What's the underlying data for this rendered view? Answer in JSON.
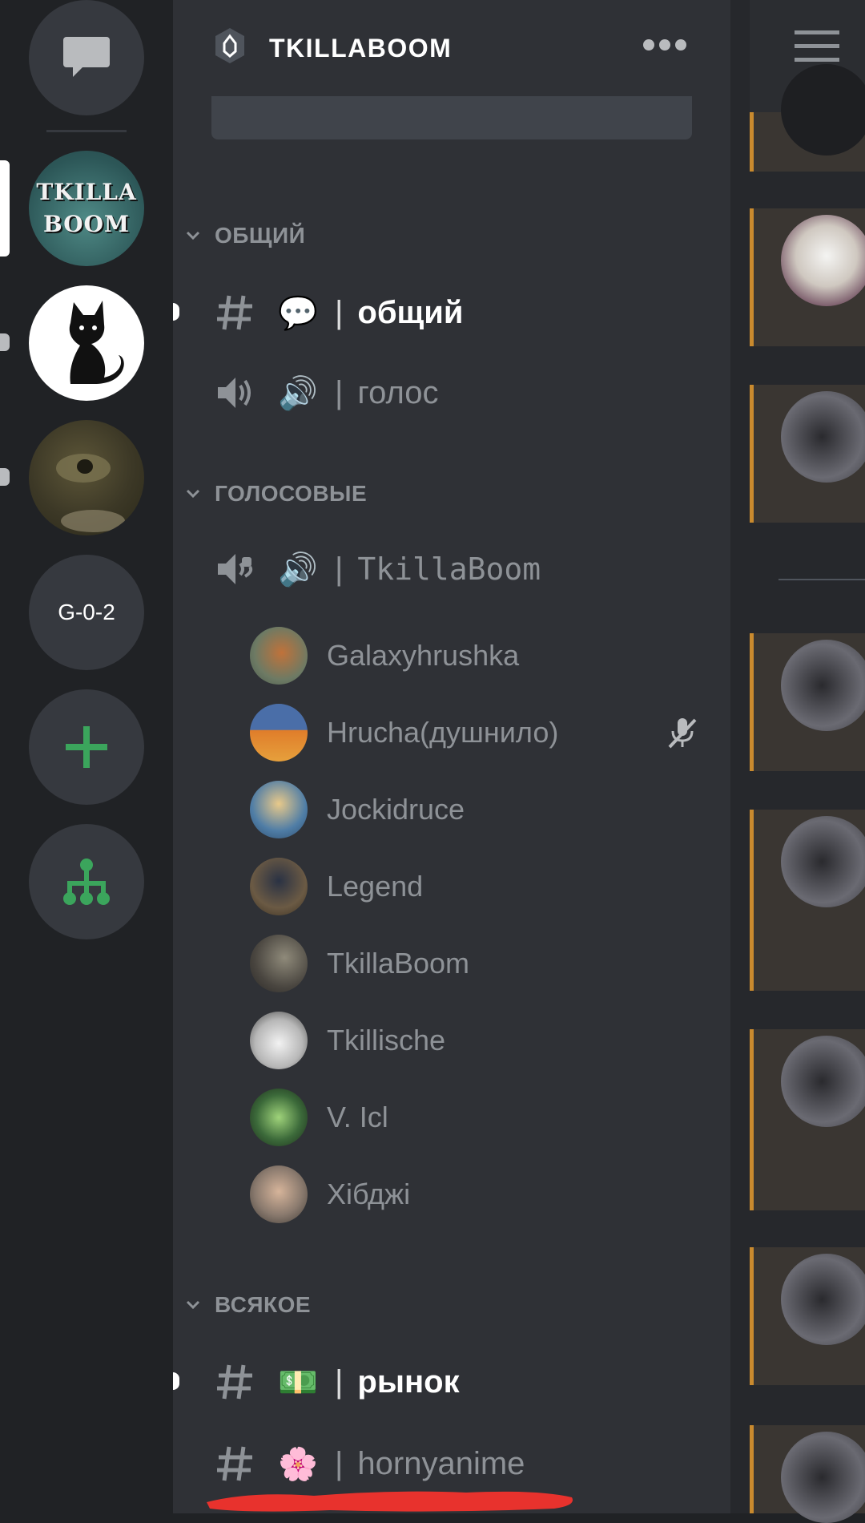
{
  "server_rail": {
    "servers": [
      {
        "name": "direct-messages",
        "icon": "chat-bubble-icon"
      },
      {
        "name": "tkillaboom",
        "label_line1": "TKILLA",
        "label_line2": "BOOM",
        "active": true
      },
      {
        "name": "cat-server",
        "icon": "black-cat-icon",
        "unread": true
      },
      {
        "name": "photo-server",
        "unread": true
      },
      {
        "name": "g02",
        "label": "G-0-2"
      },
      {
        "name": "add-server",
        "label": "+"
      },
      {
        "name": "explore",
        "icon": "hub-tree-icon"
      }
    ]
  },
  "sidebar": {
    "server_name": "TKILLABOOM",
    "categories": [
      {
        "name": "ОБЩИЙ",
        "channels": [
          {
            "type": "text",
            "emoji": "💬",
            "name": "общий",
            "unread": true
          },
          {
            "type": "voice",
            "emoji": "🔊",
            "name": "голос",
            "unread": false
          }
        ]
      },
      {
        "name": "ГОЛОСОВЫЕ",
        "channels": [
          {
            "type": "voice",
            "emoji": "🔊",
            "name": "TkillaBoom"
          }
        ],
        "voice_users": [
          {
            "name": "Galaxyhrushka",
            "muted": false
          },
          {
            "name": "Hrucha(душнило)",
            "muted": true
          },
          {
            "name": "Jockidruce",
            "muted": false
          },
          {
            "name": "Legend",
            "muted": false
          },
          {
            "name": "TkillaBoom",
            "muted": false
          },
          {
            "name": "Tkillische",
            "muted": false
          },
          {
            "name": "V. Icl",
            "muted": false
          },
          {
            "name": "Хібджі",
            "muted": false
          }
        ]
      },
      {
        "name": "ВСЯКОЕ",
        "channels": [
          {
            "type": "text",
            "emoji": "💵",
            "name": "рынок",
            "unread": true
          },
          {
            "type": "text",
            "emoji": "🌸",
            "name": "hornyanime",
            "unread": false
          }
        ]
      }
    ]
  },
  "colors": {
    "rail_bg": "#202225",
    "sidebar_bg": "#2f3136",
    "muted_text": "#8e9297",
    "accent_green": "#3ba55c",
    "scribble_red": "#e8322d",
    "card_border": "#c98a2e"
  }
}
